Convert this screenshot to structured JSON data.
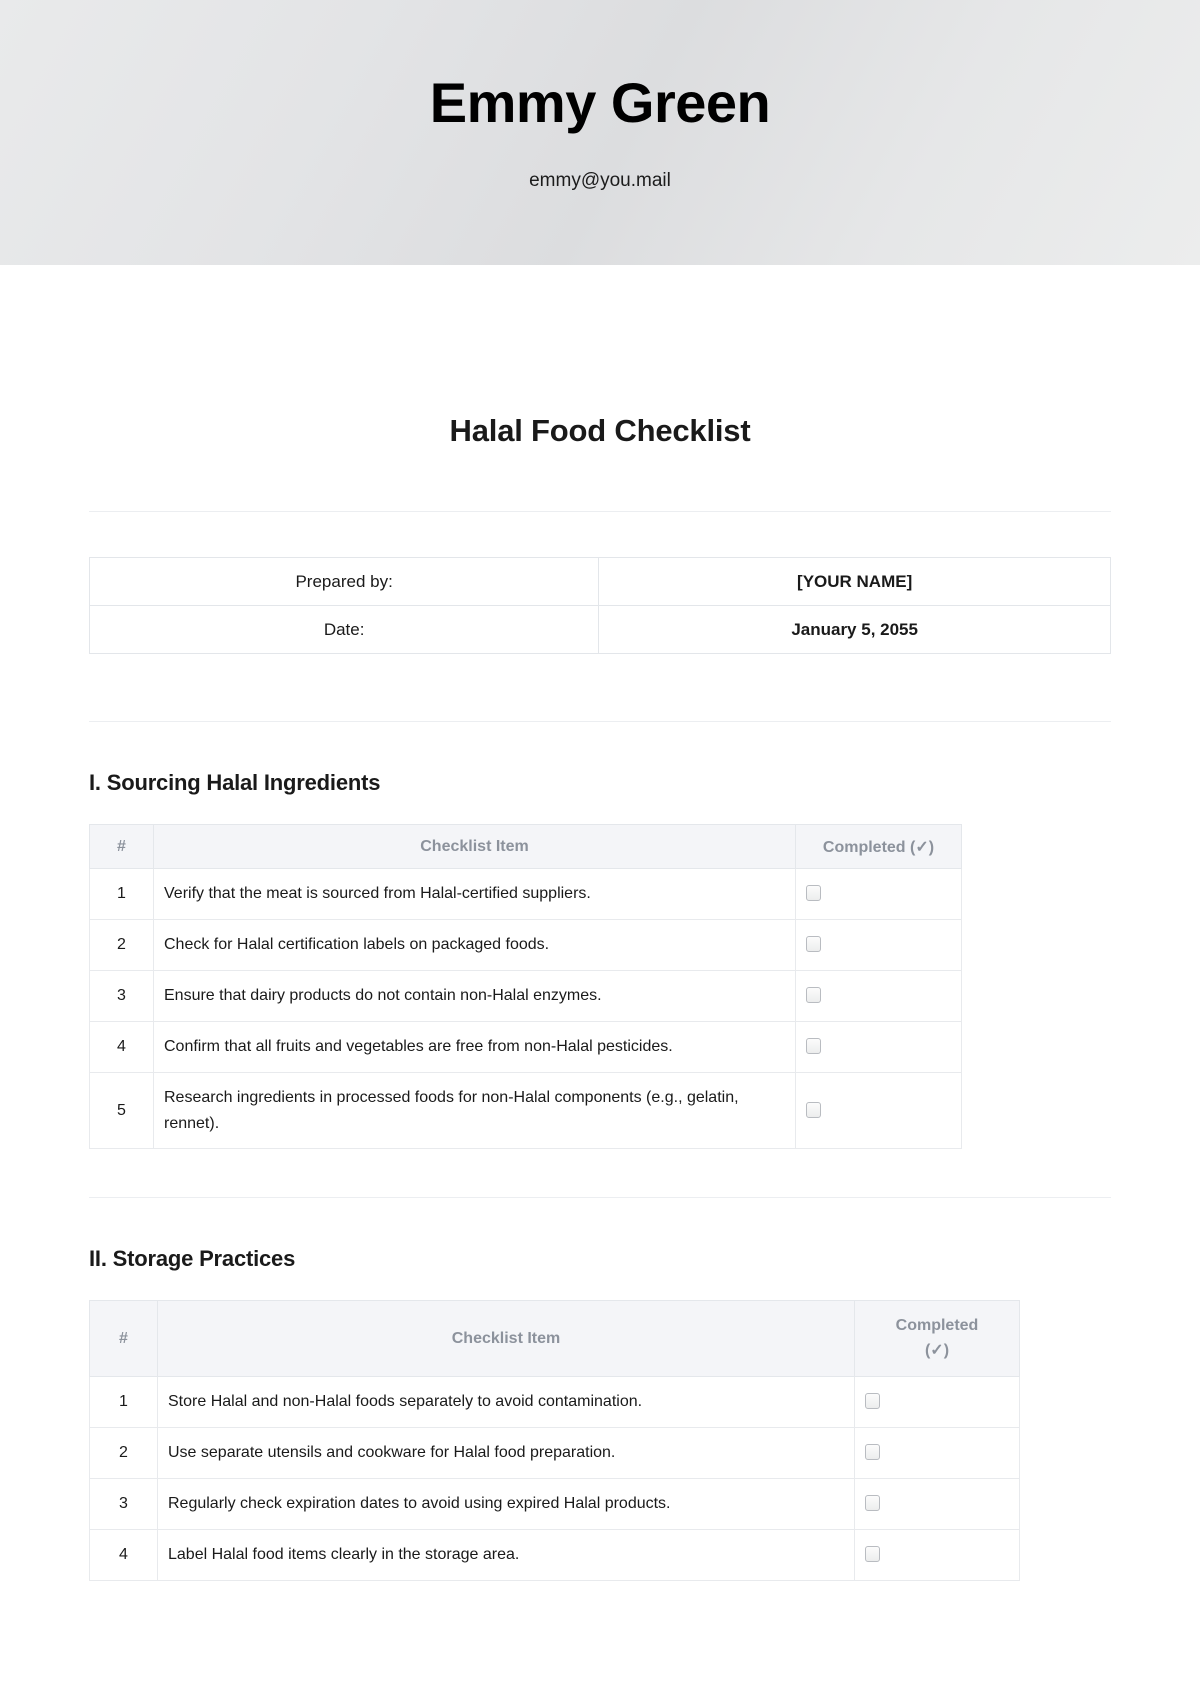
{
  "banner": {
    "name": "Emmy Green",
    "email": "emmy@you.mail"
  },
  "document": {
    "title": "Halal Food Checklist"
  },
  "info_table": {
    "rows": [
      {
        "label": "Prepared by:",
        "value": "[YOUR NAME]"
      },
      {
        "label": "Date:",
        "value": "January 5, 2055"
      }
    ]
  },
  "columns": {
    "num": "#",
    "item": "Checklist Item",
    "completed": "Completed (✓)",
    "completed_line1": "Completed",
    "completed_line2": "(✓)"
  },
  "sections": [
    {
      "heading": "I. Sourcing Halal Ingredients",
      "rows": [
        {
          "num": "1",
          "item": "Verify that the meat is sourced from Halal-certified suppliers."
        },
        {
          "num": "2",
          "item": "Check for Halal certification labels on packaged foods."
        },
        {
          "num": "3",
          "item": "Ensure that dairy products do not contain non-Halal enzymes."
        },
        {
          "num": "4",
          "item": "Confirm that all fruits and vegetables are free from non-Halal pesticides."
        },
        {
          "num": "5",
          "item": "Research ingredients in processed foods for non-Halal components (e.g., gelatin, rennet)."
        }
      ]
    },
    {
      "heading": "II. Storage Practices",
      "rows": [
        {
          "num": "1",
          "item": "Store Halal and non-Halal foods separately to avoid contamination."
        },
        {
          "num": "2",
          "item": "Use separate utensils and cookware for Halal food preparation."
        },
        {
          "num": "3",
          "item": "Regularly check expiration dates to avoid using expired Halal products."
        },
        {
          "num": "4",
          "item": "Label Halal food items clearly in the storage area."
        }
      ]
    }
  ],
  "colors": {
    "banner_bg": "#e5e6e8",
    "text": "#1a1a1a",
    "header_text": "#8c929c",
    "header_bg": "#f4f5f8",
    "border": "#e4e7eb",
    "rule": "#eceef1"
  }
}
